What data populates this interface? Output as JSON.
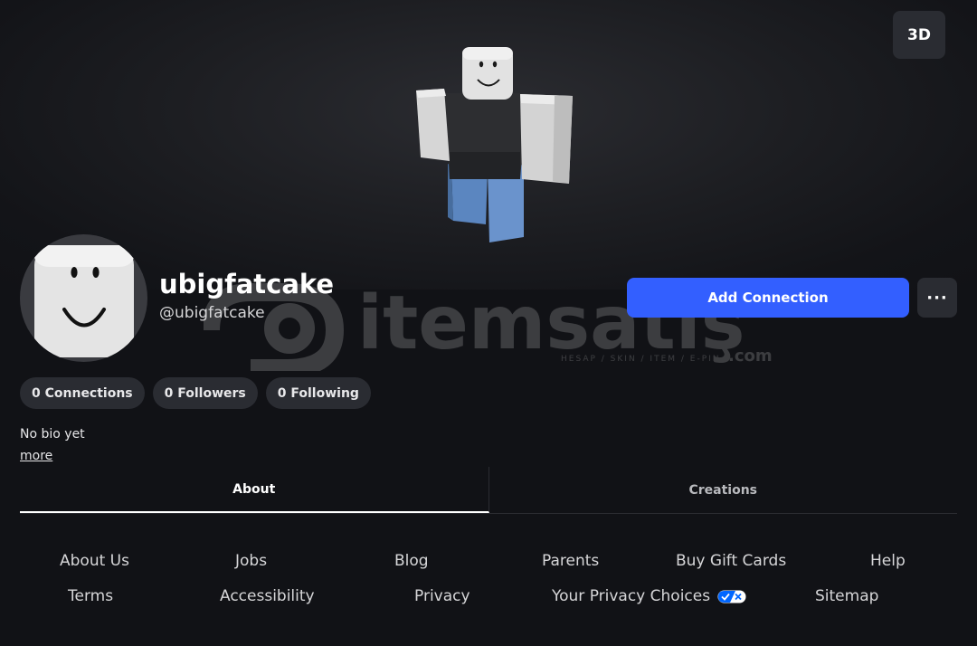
{
  "hero": {
    "view_toggle_label": "3D"
  },
  "profile": {
    "display_name": "ubigfatcake",
    "username": "@ubigfatcake",
    "add_connection_label": "Add Connection",
    "more_options_label": "···",
    "bio": "No bio yet",
    "more_link": "more"
  },
  "stats": [
    {
      "label": "0 Connections"
    },
    {
      "label": "0 Followers"
    },
    {
      "label": "0 Following"
    }
  ],
  "tabs": [
    {
      "label": "About",
      "active": true
    },
    {
      "label": "Creations",
      "active": false
    }
  ],
  "footer": {
    "row1": [
      "About Us",
      "Jobs",
      "Blog",
      "Parents",
      "Buy Gift Cards",
      "Help"
    ],
    "row2": [
      "Terms",
      "Accessibility",
      "Privacy",
      "Your Privacy Choices",
      "Sitemap"
    ]
  },
  "watermark": {
    "brand": "itemsatış",
    "tagline": "HESAP / SKIN / ITEM / E-PIN",
    "suffix": ".com"
  },
  "colors": {
    "accent": "#335fff",
    "background": "#111216",
    "pill": "#2a2c32"
  },
  "icons": {
    "privacy_choices": "privacy-choices-toggle-icon",
    "more_options": "ellipsis-icon"
  }
}
